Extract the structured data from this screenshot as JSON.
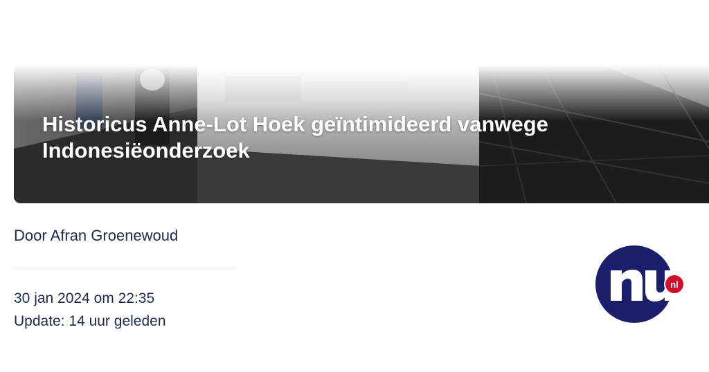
{
  "article": {
    "title": "Historicus Anne-Lot Hoek geïntimideerd vanwege Indonesiëonderzoek",
    "author": "Door Afran Groenewoud",
    "published": "30 jan 2024 om 22:35",
    "updated": "Update: 14 uur geleden"
  },
  "logo": {
    "name": "NU",
    "badge": "nl",
    "colors": {
      "circle": "#1b1f6b",
      "letters": "#ffffff",
      "badge": "#d3102c"
    }
  },
  "colors": {
    "text": "#1f2a4f",
    "divider": "#e3e3e8"
  }
}
